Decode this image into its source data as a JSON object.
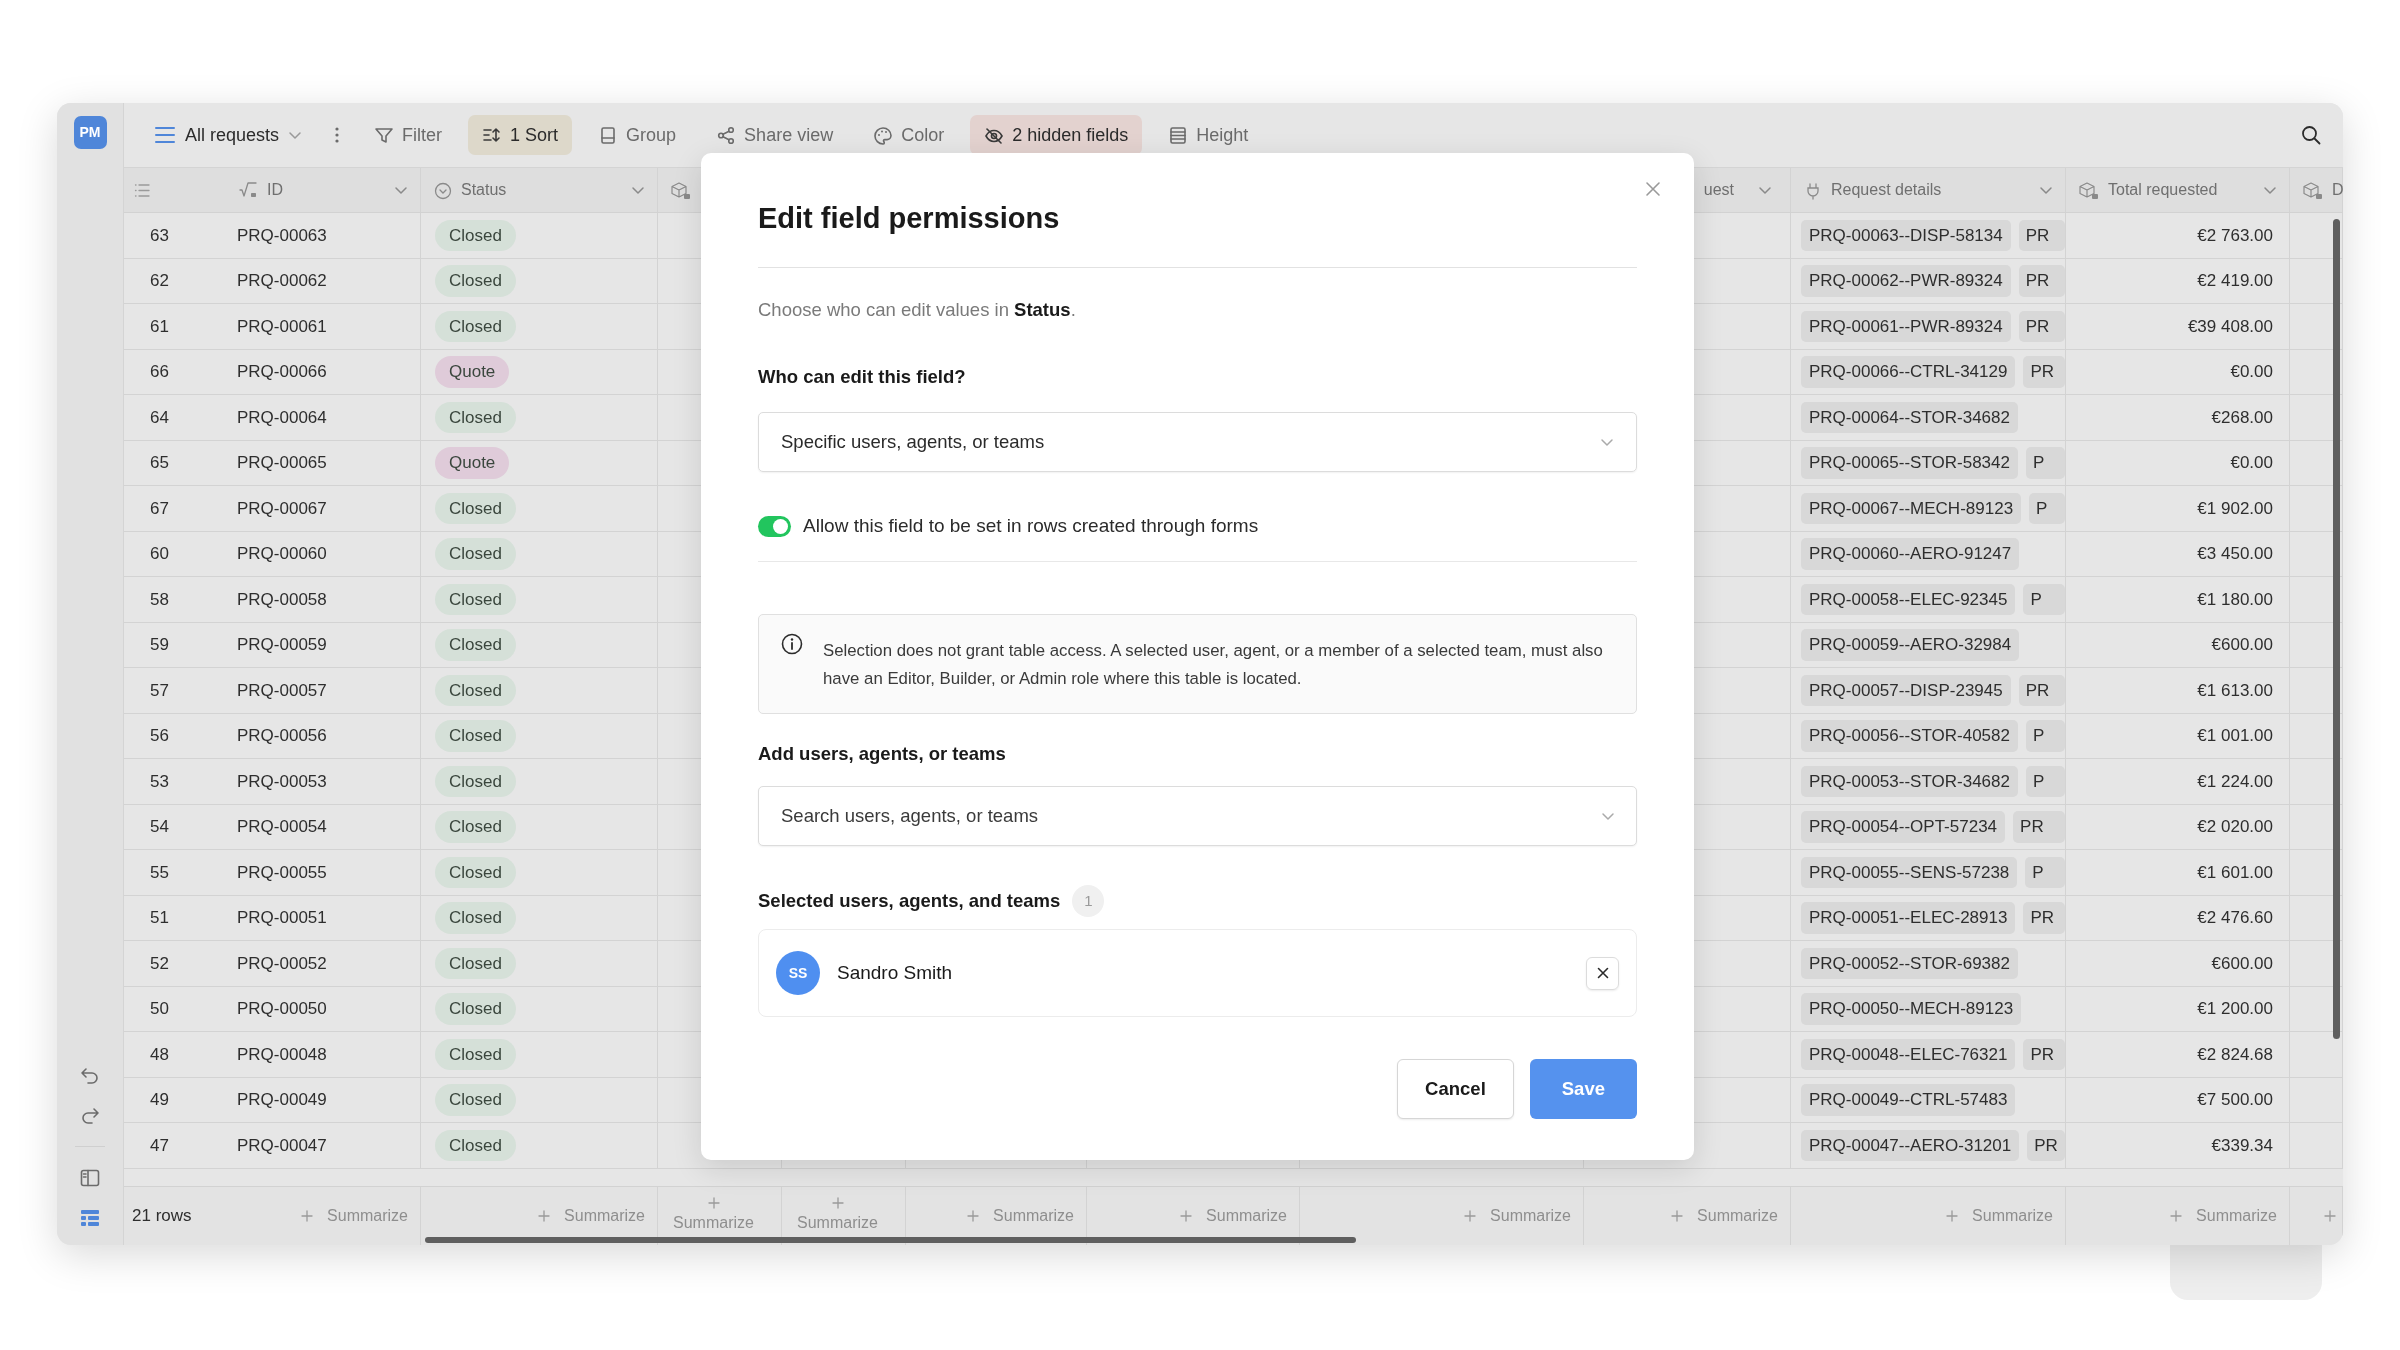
{
  "app": {
    "logo": "PM"
  },
  "toolbar": {
    "view": "All requests",
    "items": [
      {
        "kind": "filter",
        "label": "Filter",
        "active": false
      },
      {
        "kind": "sort",
        "label": "1 Sort",
        "active": true
      },
      {
        "kind": "group",
        "label": "Group",
        "active": false
      },
      {
        "kind": "share",
        "label": "Share view",
        "active": false
      },
      {
        "kind": "color",
        "label": "Color",
        "active": false
      },
      {
        "kind": "hidden",
        "label": "2 hidden fields",
        "active": true
      },
      {
        "kind": "height",
        "label": "Height",
        "active": false
      }
    ]
  },
  "table": {
    "headers": [
      {
        "kind": "formula",
        "label": "ID",
        "dropdown": true
      },
      {
        "kind": "status",
        "label": "Status",
        "dropdown": true
      },
      {
        "kind": "lookup",
        "dropdown": false
      },
      {
        "kind": "plain",
        "label": "uest",
        "dropdown": true
      },
      {
        "kind": "link",
        "label": "Request details",
        "dropdown": true
      },
      {
        "kind": "lookup",
        "label": "Total requested",
        "dropdown": true
      },
      {
        "kind": "lookup",
        "label": "D",
        "dropdown": false
      }
    ],
    "rows": [
      {
        "num": "63",
        "id": "PRQ-00063",
        "status": {
          "label": "Closed",
          "color": "#d5e0d8"
        },
        "details": [
          "PRQ-00063--DISP-58134",
          "PR"
        ],
        "total": "€2 763.00"
      },
      {
        "num": "62",
        "id": "PRQ-00062",
        "status": {
          "label": "Closed",
          "color": "#d5e0d8"
        },
        "details": [
          "PRQ-00062--PWR-89324",
          "PR"
        ],
        "total": "€2 419.00"
      },
      {
        "num": "61",
        "id": "PRQ-00061",
        "status": {
          "label": "Closed",
          "color": "#d5e0d8"
        },
        "details": [
          "PRQ-00061--PWR-89324",
          "PR"
        ],
        "total": "€39 408.00"
      },
      {
        "num": "66",
        "id": "PRQ-00066",
        "status": {
          "label": "Quote",
          "color": "#dfcbd9"
        },
        "details": [
          "PRQ-00066--CTRL-34129",
          "PR"
        ],
        "total": "€0.00"
      },
      {
        "num": "64",
        "id": "PRQ-00064",
        "status": {
          "label": "Closed",
          "color": "#d5e0d8"
        },
        "details": [
          "PRQ-00064--STOR-34682"
        ],
        "total": "€268.00"
      },
      {
        "num": "65",
        "id": "PRQ-00065",
        "status": {
          "label": "Quote",
          "color": "#dfcbd9"
        },
        "details": [
          "PRQ-00065--STOR-58342",
          "P"
        ],
        "total": "€0.00"
      },
      {
        "num": "67",
        "id": "PRQ-00067",
        "status": {
          "label": "Closed",
          "color": "#d5e0d8"
        },
        "details": [
          "PRQ-00067--MECH-89123",
          "P"
        ],
        "total": "€1 902.00"
      },
      {
        "num": "60",
        "id": "PRQ-00060",
        "status": {
          "label": "Closed",
          "color": "#d5e0d8"
        },
        "details": [
          "PRQ-00060--AERO-91247"
        ],
        "total": "€3 450.00"
      },
      {
        "num": "58",
        "id": "PRQ-00058",
        "status": {
          "label": "Closed",
          "color": "#d5e0d8"
        },
        "details": [
          "PRQ-00058--ELEC-92345",
          "P"
        ],
        "total": "€1 180.00"
      },
      {
        "num": "59",
        "id": "PRQ-00059",
        "status": {
          "label": "Closed",
          "color": "#d5e0d8"
        },
        "details": [
          "PRQ-00059--AERO-32984"
        ],
        "total": "€600.00"
      },
      {
        "num": "57",
        "id": "PRQ-00057",
        "status": {
          "label": "Closed",
          "color": "#d5e0d8"
        },
        "details": [
          "PRQ-00057--DISP-23945",
          "PR"
        ],
        "total": "€1 613.00"
      },
      {
        "num": "56",
        "id": "PRQ-00056",
        "status": {
          "label": "Closed",
          "color": "#d5e0d8"
        },
        "details": [
          "PRQ-00056--STOR-40582",
          "P"
        ],
        "total": "€1 001.00"
      },
      {
        "num": "53",
        "id": "PRQ-00053",
        "status": {
          "label": "Closed",
          "color": "#d5e0d8"
        },
        "details": [
          "PRQ-00053--STOR-34682",
          "P"
        ],
        "total": "€1 224.00"
      },
      {
        "num": "54",
        "id": "PRQ-00054",
        "status": {
          "label": "Closed",
          "color": "#d5e0d8"
        },
        "details": [
          "PRQ-00054--OPT-57234",
          "PR"
        ],
        "total": "€2 020.00"
      },
      {
        "num": "55",
        "id": "PRQ-00055",
        "status": {
          "label": "Closed",
          "color": "#d5e0d8"
        },
        "details": [
          "PRQ-00055--SENS-57238",
          "P"
        ],
        "total": "€1 601.00"
      },
      {
        "num": "51",
        "id": "PRQ-00051",
        "status": {
          "label": "Closed",
          "color": "#d5e0d8"
        },
        "details": [
          "PRQ-00051--ELEC-28913",
          "PR"
        ],
        "total": "€2 476.60"
      },
      {
        "num": "52",
        "id": "PRQ-00052",
        "status": {
          "label": "Closed",
          "color": "#d5e0d8"
        },
        "details": [
          "PRQ-00052--STOR-69382"
        ],
        "total": "€600.00"
      },
      {
        "num": "50",
        "id": "PRQ-00050",
        "status": {
          "label": "Closed",
          "color": "#d5e0d8"
        },
        "details": [
          "PRQ-00050--MECH-89123"
        ],
        "total": "€1 200.00"
      },
      {
        "num": "48",
        "id": "PRQ-00048",
        "status": {
          "label": "Closed",
          "color": "#d5e0d8"
        },
        "details": [
          "PRQ-00048--ELEC-76321",
          "PR"
        ],
        "total": "€2 824.68"
      },
      {
        "num": "49",
        "id": "PRQ-00049",
        "status": {
          "label": "Closed",
          "color": "#d5e0d8"
        },
        "details": [
          "PRQ-00049--CTRL-57483"
        ],
        "total": "€7 500.00"
      },
      {
        "num": "47",
        "id": "PRQ-00047",
        "status": {
          "label": "Closed",
          "color": "#d5e0d8"
        },
        "details": [
          "PRQ-00047--AERO-31201",
          "PR"
        ],
        "total": "€339.34"
      }
    ]
  },
  "footer": {
    "row_count": "21 rows",
    "summaries": [
      {
        "label": "Summarize",
        "stacked": false
      },
      {
        "label": "Summarize",
        "stacked": false
      },
      {
        "label": "Summarize",
        "stacked": true
      },
      {
        "label": "Summarize",
        "stacked": true
      },
      {
        "label": "Summarize",
        "stacked": false
      },
      {
        "label": "Summarize",
        "stacked": false
      },
      {
        "label": "Summarize",
        "stacked": false
      },
      {
        "label": "Summarize",
        "stacked": false
      },
      {
        "label": "Summarize",
        "stacked": false
      },
      {
        "label": "Summarize",
        "stacked": false
      }
    ]
  },
  "dialog": {
    "title": "Edit field permissions",
    "description": "Choose who can edit values in **Status**.",
    "who_label": "Who can edit this field?",
    "who_value": "Specific users, agents, or teams",
    "toggle": {
      "label": "Allow this field to be set in rows created through forms",
      "on": true
    },
    "info": "Selection does not grant table access. A selected user, agent, or a member of a selected team, must also have an Editor, Builder, or Admin role where this table is located.",
    "add_label": "Add users, agents, or teams",
    "search": {
      "placeholder": "Search users, agents, or teams"
    },
    "selected_label": "Selected users, agents, and teams",
    "selected_count": "1",
    "members": [
      {
        "initials": "SS",
        "name": "Sandro Smith"
      }
    ],
    "buttons": [
      {
        "kind": "secondary",
        "label": "Cancel"
      },
      {
        "kind": "primary",
        "label": "Save"
      }
    ]
  }
}
